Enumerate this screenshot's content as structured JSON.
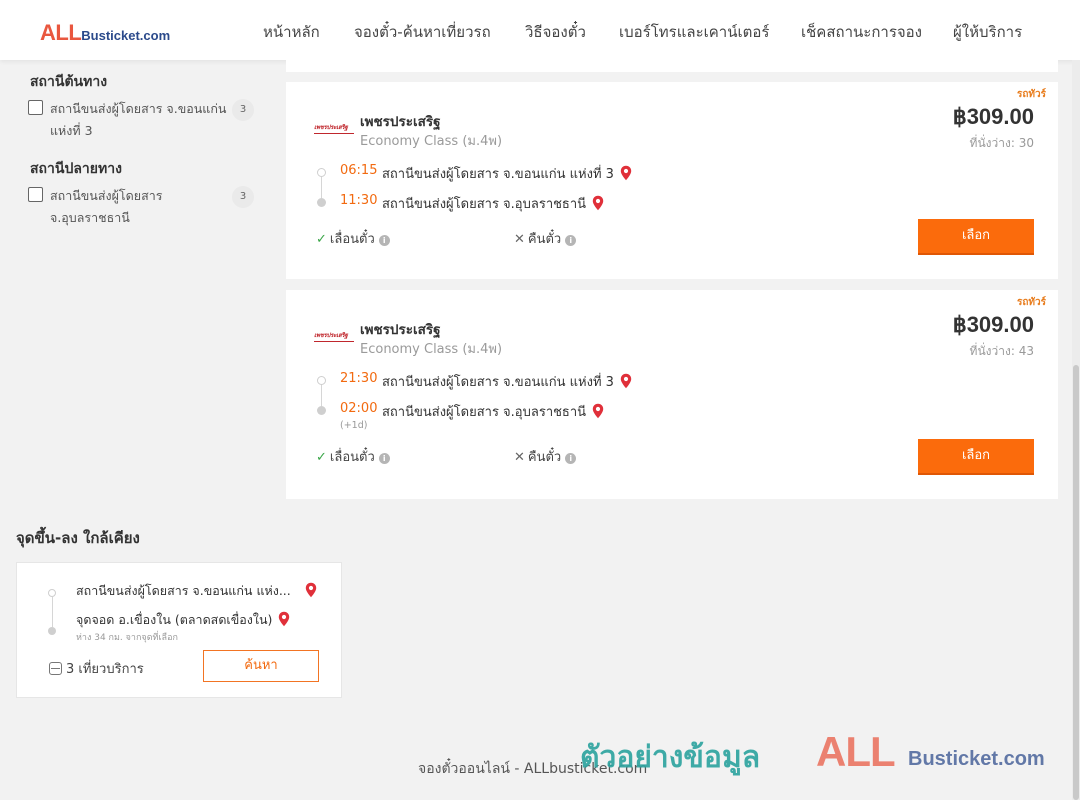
{
  "header": {
    "logo": {
      "all": "ALL",
      "rest": "Busticket.com"
    },
    "nav": [
      {
        "label": "หน้าหลัก"
      },
      {
        "label": "จองตั๋ว-ค้นหาเที่ยวรถ"
      },
      {
        "label": "วิธีจองตั๋ว"
      },
      {
        "label": "เบอร์โทรและเคาน์เตอร์"
      },
      {
        "label": "เช็คสถานะการจอง"
      },
      {
        "label": "ผู้ให้บริการ"
      }
    ]
  },
  "filters": {
    "origin": {
      "title": "สถานีต้นทาง",
      "items": [
        {
          "label": "สถานีขนส่งผู้โดยสาร จ.ขอนแก่น แห่งที่ 3",
          "count": "3",
          "checked": false
        }
      ]
    },
    "destination": {
      "title": "สถานีปลายทาง",
      "items": [
        {
          "label": "สถานีขนส่งผู้โดยสาร จ.อุบลราชธานี",
          "count": "3",
          "checked": false
        }
      ]
    }
  },
  "trips": [
    {
      "tag": "รถทัวร์",
      "operator_logo": "เพชรประเสริฐ",
      "operator": "เพชรประเสริฐ",
      "bus_class": "Economy Class (ม.4พ)",
      "price": "฿309.00",
      "seats_label": "ที่นั่งว่าง:",
      "seats_count": "30",
      "depart_time": "06:15",
      "depart_station": "สถานีขนส่งผู้โดยสาร จ.ขอนแก่น แห่งที่ 3",
      "arrive_time": "11:30",
      "arrive_station": "สถานีขนส่งผู้โดยสาร จ.อุบลราชธานี",
      "next_day": "",
      "feature_yes": "เลื่อนตั๋ว",
      "feature_no": "คืนตั๋ว",
      "select_label": "เลือก"
    },
    {
      "tag": "รถทัวร์",
      "operator_logo": "เพชรประเสริฐ",
      "operator": "เพชรประเสริฐ",
      "bus_class": "Economy Class (ม.4พ)",
      "price": "฿309.00",
      "seats_label": "ที่นั่งว่าง:",
      "seats_count": "43",
      "depart_time": "21:30",
      "depart_station": "สถานีขนส่งผู้โดยสาร จ.ขอนแก่น แห่งที่ 3",
      "arrive_time": "02:00",
      "arrive_station": "สถานีขนส่งผู้โดยสาร จ.อุบลราชธานี",
      "next_day": "(+1d)",
      "feature_yes": "เลื่อนตั๋ว",
      "feature_no": "คืนตั๋ว",
      "select_label": "เลือก"
    }
  ],
  "nearby": {
    "title": "จุดขึ้น-ลง ใกล้เคียง",
    "from_station": "สถานีขนส่งผู้โดยสาร จ.ขอนแก่น แห่ง...",
    "to_station": "จุดจอด อ.เขื่องใน (ตลาดสดเขื่องใน)",
    "distance": "ห่าง 34 กม. จากจุดที่เลือก",
    "trips": "3 เที่ยวบริการ",
    "search_label": "ค้นหา"
  },
  "footer": {
    "text": "จองตั๋วออนไลน์ - ALLbusticket.com"
  },
  "watermark": {
    "thai": "ตัวอย่างข้อมูล",
    "all": "ALL",
    "rest": "Busticket.com"
  },
  "colors": {
    "accent": "#fb6b0c",
    "time": "#f26a10",
    "pin": "#e0303a",
    "check": "#3aa648",
    "tag": "#e87d1e"
  }
}
